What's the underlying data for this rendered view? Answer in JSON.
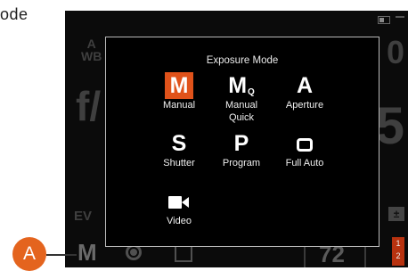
{
  "page": {
    "partial_text": "ode"
  },
  "background": {
    "wb_top": "A",
    "wb_bottom": "WB",
    "aperture_prefix": "f/",
    "ev_label": "EV",
    "mode_letter": "M",
    "shots_remaining": "72",
    "flag_top": "1",
    "flag_bottom": "2"
  },
  "dialog": {
    "title": "Exposure Mode",
    "modes": [
      {
        "id": "manual",
        "glyph": "M",
        "label": "Manual",
        "selected": true
      },
      {
        "id": "manual-quick",
        "glyph": "M",
        "glyph_sub": "Q",
        "label": "Manual",
        "label2": "Quick",
        "selected": false
      },
      {
        "id": "aperture",
        "glyph": "A",
        "label": "Aperture",
        "selected": false
      },
      {
        "id": "shutter",
        "glyph": "S",
        "label": "Shutter",
        "selected": false
      },
      {
        "id": "program",
        "glyph": "P",
        "label": "Program",
        "selected": false
      },
      {
        "id": "full-auto",
        "icon": "rounded-square-icon",
        "label": "Full Auto",
        "selected": false
      },
      {
        "id": "video",
        "icon": "video-camera-icon",
        "label": "Video",
        "selected": false
      }
    ]
  },
  "callout": {
    "letter": "A",
    "color": "#e4641e"
  },
  "colors": {
    "selected_bg": "#e0521a",
    "screen_bg": "#0b0b0b",
    "dialog_border": "#b9b9b9"
  }
}
